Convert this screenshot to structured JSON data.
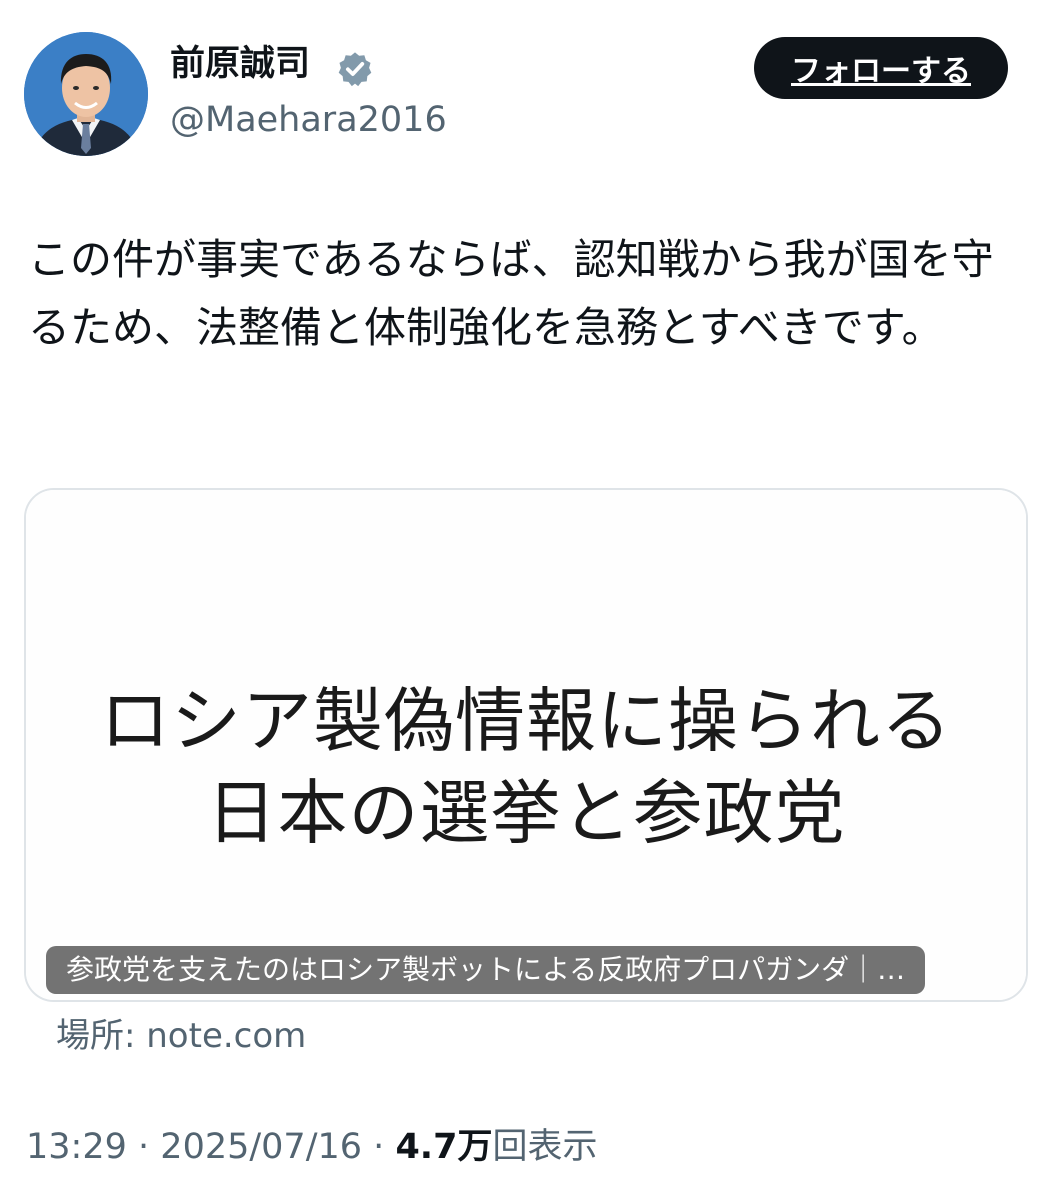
{
  "author": {
    "display_name": "前原誠司",
    "handle": "@Maehara2016",
    "verified_icon": "verified-badge-icon",
    "badge_color": "#829aab"
  },
  "follow_button": {
    "label": "フォローする"
  },
  "tweet": {
    "text": "この件が事実であるならば、認知戦から我が国を守るため、法整備と体制強化を急務とすべきです。"
  },
  "card": {
    "image_text_line1": "ロシア製偽情報に操られる",
    "image_text_line2": "日本の選挙と参政党",
    "caption": "参政党を支えたのはロシア製ボットによる反政府プロパガンダ｜…",
    "source": "場所: note.com"
  },
  "meta": {
    "time": "13:29",
    "separator": "·",
    "date": "2025/07/16",
    "views_count": "4.7",
    "views_unit": "万",
    "views_label": "回表示"
  }
}
